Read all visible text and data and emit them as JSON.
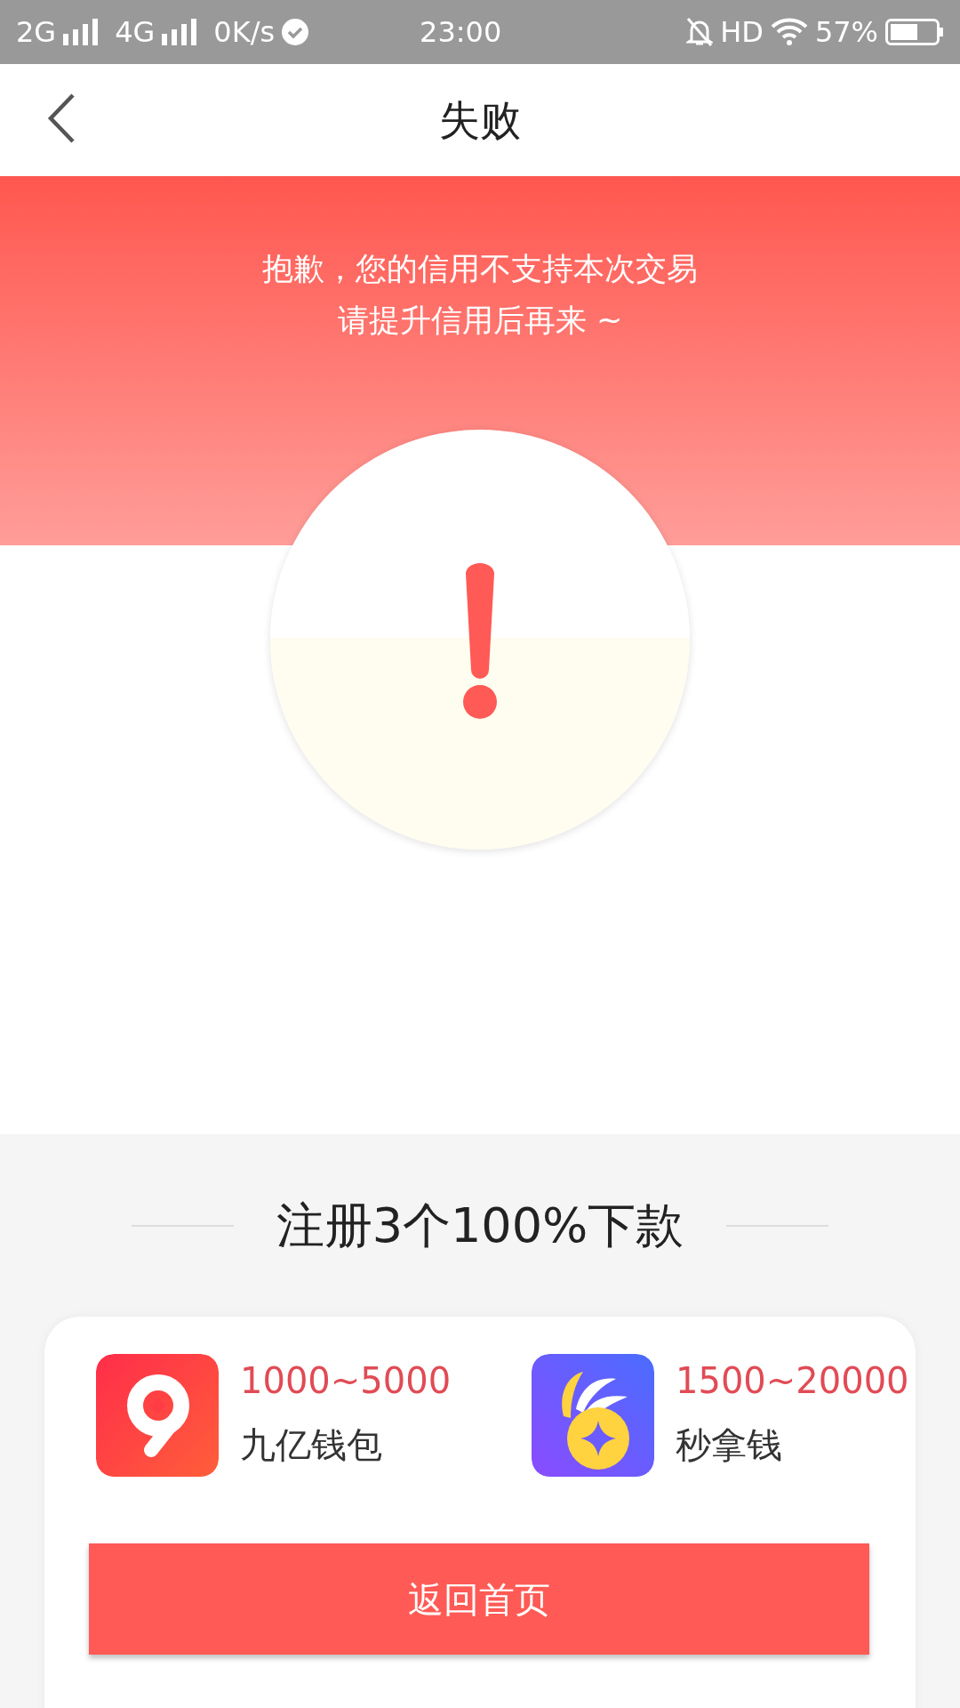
{
  "status_bar": {
    "network_1": "2G",
    "network_2": "4G",
    "speed": "0K/s",
    "time": "23:00",
    "hd": "HD",
    "battery": "57%"
  },
  "header": {
    "title": "失败"
  },
  "banner": {
    "lines": [
      "抱歉，您的信用不支持本次交易",
      "请提升信用后再来 ~"
    ]
  },
  "section": {
    "title": "注册3个100%下款"
  },
  "apps": [
    {
      "kind": "nine",
      "amount": "1000~5000",
      "name": "九亿钱包"
    },
    {
      "kind": "coin",
      "amount": "1500~20000",
      "name": "秒拿钱"
    }
  ],
  "button": {
    "label": "返回首页"
  }
}
